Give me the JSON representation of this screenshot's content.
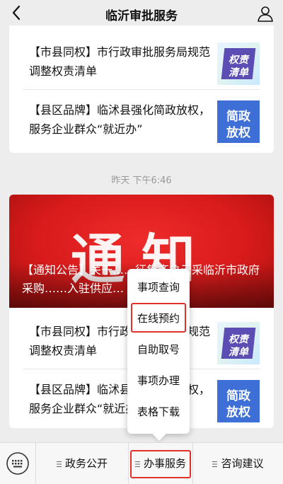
{
  "nav": {
    "title": "临沂审批服务"
  },
  "card1": {
    "items": [
      {
        "text": "【市县同权】市行政审批服务局规范调整权责清单",
        "thumb": [
          "权责",
          "清单"
        ]
      },
      {
        "text": "【县区品牌】临沭县强化简政放权，服务企业群众“就近办”",
        "thumb": [
          "简政",
          "放权"
        ]
      }
    ]
  },
  "timestamp": "昨天 下午6:46",
  "card2": {
    "banner_big": "通知",
    "banner_caption": "【通知公告】关于……征集齐鲁云采临沂市政府采购……入驻供应…",
    "items": [
      {
        "text": "【市县同权】市行政审批服务局规范调整权责清单",
        "thumb": [
          "权责",
          "清单"
        ]
      },
      {
        "text": "【县区品牌】临沭县强化简政放权，服务企业群众“就近办”",
        "thumb": [
          "简政",
          "放权"
        ]
      }
    ]
  },
  "popup": {
    "items": [
      "事项查询",
      "在线预约",
      "自助取号",
      "事项办理",
      "表格下载"
    ],
    "highlighted": "在线预约"
  },
  "tabbar": {
    "tabs": [
      "政务公开",
      "办事服务",
      "咨询建议"
    ],
    "active": "办事服务"
  },
  "colors": {
    "highlight": "#e0322b",
    "banner": "#d91b1b",
    "thumb_blue": "#3e6fd6",
    "thumb_purple": "#5b4db3"
  }
}
